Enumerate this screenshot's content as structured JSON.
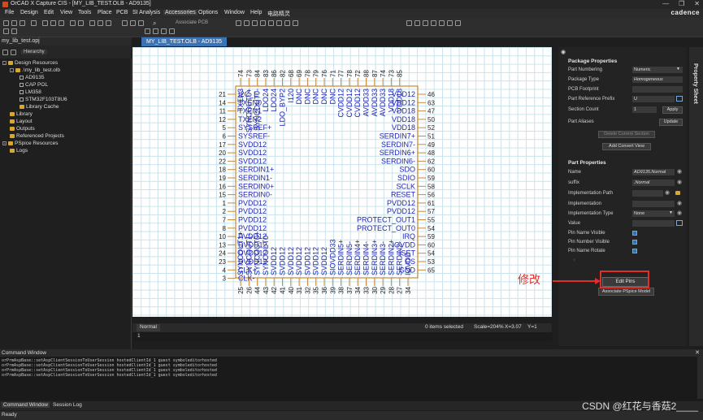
{
  "window": {
    "title": "OrCAD X Capture CIS - [MY_LIB_TEST.OLB - AD9135]",
    "controls": [
      "—",
      "❐",
      "✕"
    ]
  },
  "menubar": {
    "items": [
      "File",
      "Design",
      "Edit",
      "View",
      "Tools",
      "Place",
      "PCB",
      "SI Analysis",
      "Accessories",
      "Options",
      "Window",
      "Help",
      "电路精灵"
    ],
    "brand": "cadence"
  },
  "toolbar": {
    "associate_label": "Associate PCB"
  },
  "project": {
    "file": "my_lib_test.opj",
    "tree_header": "Hierarchy",
    "items": [
      {
        "label": "Design Resources",
        "icon": "folder-icon"
      },
      {
        "label": ".\\my_lib_test.olb",
        "icon": "folder-icon"
      },
      {
        "label": "AD9135",
        "icon": "part-icon"
      },
      {
        "label": "CAP POL",
        "icon": "part-icon"
      },
      {
        "label": "LM358",
        "icon": "part-icon"
      },
      {
        "label": "STM32F103T8U6",
        "icon": "part-icon"
      },
      {
        "label": "Library Cache",
        "icon": "folder-icon"
      },
      {
        "label": "Library",
        "icon": "folder-icon"
      },
      {
        "label": "Layout",
        "icon": "folder-icon"
      },
      {
        "label": "Outputs",
        "icon": "folder-icon"
      },
      {
        "label": "Referenced Projects",
        "icon": "folder-icon"
      },
      {
        "label": "PSpice Resources",
        "icon": "folder-icon"
      },
      {
        "label": "Logs",
        "icon": "folder-icon"
      }
    ]
  },
  "editor": {
    "tab": "MY_LIB_TEST.OLB - AD9135",
    "view_tab": "Normal",
    "status": {
      "selected": "0 items selected",
      "scale": "Scale=204%",
      "x": "X=3.07",
      "y": "Y=1"
    },
    "cmd_value": "1",
    "left_pins": [
      {
        "num": "21",
        "name": "I2C_E"
      },
      {
        "num": "14",
        "name": "TXEN0"
      },
      {
        "num": "11",
        "name": "TXEN1"
      },
      {
        "num": "12",
        "name": "TXEN2"
      },
      {
        "num": "5",
        "name": "SYSREF+"
      },
      {
        "num": "6",
        "name": "SYSREF-"
      },
      {
        "num": "17",
        "name": "SVDD12"
      },
      {
        "num": "20",
        "name": "SVDD12"
      },
      {
        "num": "22",
        "name": "SVDD12"
      },
      {
        "num": "18",
        "name": "SERDIN1+"
      },
      {
        "num": "19",
        "name": "SERDIN1-"
      },
      {
        "num": "16",
        "name": "SERDIN0+"
      },
      {
        "num": "15",
        "name": "SERDIN0-"
      },
      {
        "num": "1",
        "name": "PVDD12"
      },
      {
        "num": "2",
        "name": "PVDD12"
      },
      {
        "num": "7",
        "name": "PVDD12"
      },
      {
        "num": "8",
        "name": "PVDD12"
      },
      {
        "num": "10",
        "name": "PVDD12"
      },
      {
        "num": "13",
        "name": "DVDD12"
      },
      {
        "num": "24",
        "name": "DVDD12"
      },
      {
        "num": "23",
        "name": "DVDD12"
      },
      {
        "num": "4",
        "name": "CLK+"
      },
      {
        "num": "3",
        "name": "CLK-"
      }
    ],
    "right_pins": [
      {
        "num": "46",
        "name": "VDD12"
      },
      {
        "num": "63",
        "name": "VDD12"
      },
      {
        "num": "47",
        "name": "VDD18"
      },
      {
        "num": "50",
        "name": "VDD18"
      },
      {
        "num": "52",
        "name": "VDD18"
      },
      {
        "num": "51",
        "name": "SERDIN7+"
      },
      {
        "num": "49",
        "name": "SERDIN7-"
      },
      {
        "num": "48",
        "name": "SERDIN6+"
      },
      {
        "num": "62",
        "name": "SERDIN6-"
      },
      {
        "num": "60",
        "name": "SDO"
      },
      {
        "num": "59",
        "name": "SDIO"
      },
      {
        "num": "58",
        "name": "SCLK"
      },
      {
        "num": "56",
        "name": "RESET"
      },
      {
        "num": "61",
        "name": "PVDD12"
      },
      {
        "num": "57",
        "name": "PVDD12"
      },
      {
        "num": "55",
        "name": "PROTECT_OUT1"
      },
      {
        "num": "54",
        "name": "PROTECT_OUT0"
      },
      {
        "num": "59",
        "name": "IRQ"
      },
      {
        "num": "60",
        "name": "IOVDD"
      },
      {
        "num": "54",
        "name": "ISET"
      },
      {
        "num": "53",
        "name": "CS"
      },
      {
        "num": "65",
        "name": "GND"
      }
    ],
    "top_pins": [
      {
        "num": "74",
        "name": "TXEN3"
      },
      {
        "num": "73",
        "name": "SYNCOUT0+"
      },
      {
        "num": "84",
        "name": "SYNCOUT0-"
      },
      {
        "num": "83",
        "name": "LDO24"
      },
      {
        "num": "86",
        "name": "LDO24"
      },
      {
        "num": "82",
        "name": "LDO_BYP2"
      },
      {
        "num": "68",
        "name": "I120"
      },
      {
        "num": "69",
        "name": "DNC"
      },
      {
        "num": "78",
        "name": "DNC"
      },
      {
        "num": "79",
        "name": "DNC"
      },
      {
        "num": "76",
        "name": "DNC"
      },
      {
        "num": "71",
        "name": "DNC"
      },
      {
        "num": "77",
        "name": "CVDD12"
      },
      {
        "num": "78",
        "name": "CVDD12"
      },
      {
        "num": "72",
        "name": "CVDD12"
      },
      {
        "num": "88",
        "name": "AVDD33"
      },
      {
        "num": "87",
        "name": "AVDD33"
      },
      {
        "num": "74",
        "name": "AVDD33"
      },
      {
        "num": "73",
        "name": "VDD18"
      },
      {
        "num": "85",
        "name": "VDD18"
      }
    ],
    "bottom_pins": [
      {
        "num": "25",
        "name": "SYNCOUT1+"
      },
      {
        "num": "26",
        "name": "SYNCOUT1-"
      },
      {
        "num": "44",
        "name": "SYNCOUT0+"
      },
      {
        "num": "43",
        "name": "SYNCOUT0-"
      },
      {
        "num": "42",
        "name": "SVDD12"
      },
      {
        "num": "41",
        "name": "SVDD12"
      },
      {
        "num": "40",
        "name": "SVDD12"
      },
      {
        "num": "31",
        "name": "SVDD12"
      },
      {
        "num": "32",
        "name": "SVDD12"
      },
      {
        "num": "35",
        "name": "SVDD12"
      },
      {
        "num": "36",
        "name": "SVDD12"
      },
      {
        "num": "39",
        "name": "SIOVDD33"
      },
      {
        "num": "38",
        "name": "SERDIN5+"
      },
      {
        "num": "37",
        "name": "SERDIN5-"
      },
      {
        "num": "34",
        "name": "SERDIN4+"
      },
      {
        "num": "33",
        "name": "SERDIN4-"
      },
      {
        "num": "30",
        "name": "SERDIN3+"
      },
      {
        "num": "29",
        "name": "SERDIN3-"
      },
      {
        "num": "28",
        "name": "SERDIN2+"
      },
      {
        "num": "27",
        "name": "SERDIN2-"
      },
      {
        "num": "34",
        "name": "IOVDD"
      }
    ]
  },
  "properties": {
    "package_header": "Package Properties",
    "package": [
      {
        "label": "Part Numbering",
        "value": "Numeric",
        "kind": "select"
      },
      {
        "label": "Package Type",
        "value": "Homogeneous",
        "kind": "text"
      },
      {
        "label": "PCB Footprint",
        "value": "",
        "kind": "text"
      },
      {
        "label": "Part Reference Prefix",
        "value": "U",
        "kind": "text"
      },
      {
        "label": "Section Count",
        "value": "1",
        "kind": "text"
      },
      {
        "label": "Part Aliases",
        "value": "",
        "kind": "none"
      }
    ],
    "apply_label": "Apply",
    "update_label": "Update",
    "delete_section_label": "Delete Current Section",
    "add_convert_label": "Add Convert View",
    "part_header": "Part Properties",
    "part": [
      {
        "label": "Name",
        "value": "AD9135.Normal",
        "kind": "text"
      },
      {
        "label": "suffix",
        "value": ".Normal",
        "kind": "text"
      },
      {
        "label": "Implementation Path",
        "value": "",
        "kind": "text"
      },
      {
        "label": "Implementation",
        "value": "",
        "kind": "text"
      },
      {
        "label": "Implementation Type",
        "value": "None",
        "kind": "select"
      },
      {
        "label": "Value",
        "value": "",
        "kind": "text"
      },
      {
        "label": "Pin Name Visible",
        "value": "",
        "kind": "check"
      },
      {
        "label": "Pin Number Visible",
        "value": "",
        "kind": "check"
      },
      {
        "label": "Pin Name Rotate",
        "value": "",
        "kind": "check"
      }
    ],
    "edit_pins_label": "Edit Pins",
    "associate_pspice_label": "Associate PSpice Model",
    "sheet_tab": "Property Sheet",
    "annotation": "修改"
  },
  "command_window": {
    "title": "Command Window",
    "lines": [
      "orPrmAspBase::setAspClientSessionToUserSession hostedClientId_1 guest symboleditorhosted",
      "orPrmAspBase::setAspClientSessionToUserSession hostedClientId_1 guest symboleditorhosted",
      "orPrmAspBase::setAspClientSessionToUserSession hostedClientId_1 guest symboleditorhosted",
      "orPrmAspBase::setAspClientSessionToUserSession hostedClientId_1 guest symboleditorhosted"
    ],
    "tabs": [
      "Command Window",
      "Session Log"
    ]
  },
  "statusbar": {
    "text": "Ready"
  },
  "watermark": "CSDN @红花与香菇2____",
  "colors": {
    "accent": "#3c73b6",
    "pin_text": "#1f24b4",
    "body_outline": "#c98a3a",
    "annotation": "#e0302a"
  }
}
